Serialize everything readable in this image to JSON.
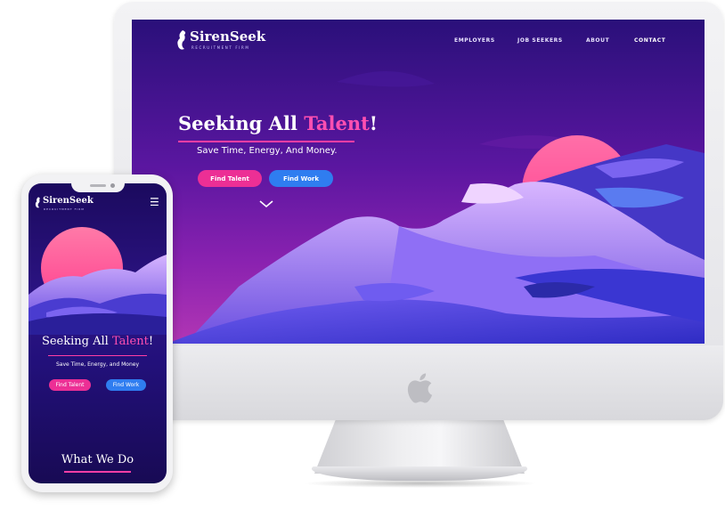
{
  "desktop": {
    "brand": {
      "name": "SirenSeek",
      "tagline": "RECRUITMENT FIRM"
    },
    "nav": {
      "employers": "EMPLOYERS",
      "job_seekers": "JOB SEEKERS",
      "about": "ABOUT",
      "contact": "CONTACT"
    },
    "hero": {
      "title_part1": "Seeking All ",
      "title_highlight": "Talent",
      "title_end": "!",
      "subtitle": "Save Time, Energy, And Money.",
      "find_talent": "Find Talent",
      "find_work": "Find Work"
    }
  },
  "mobile": {
    "brand": {
      "name": "SirenSeek",
      "tagline": "RECRUITMENT FIRM"
    },
    "menu_icon": "☰",
    "hero": {
      "title_part1": "Seeking All ",
      "title_highlight": "Talent",
      "title_end": "!",
      "subtitle": "Save Time, Energy, and Money",
      "find_talent": "Find Talent",
      "find_work": "Find Work"
    },
    "section_title": "What We Do"
  },
  "colors": {
    "accent_pink": "#ec2f95",
    "accent_blue": "#2f7df0",
    "bg_deep": "#1b0a5e"
  },
  "icons": [
    "siren-logo-icon",
    "chevron-down-icon",
    "hamburger-menu-icon",
    "apple-logo-icon"
  ]
}
